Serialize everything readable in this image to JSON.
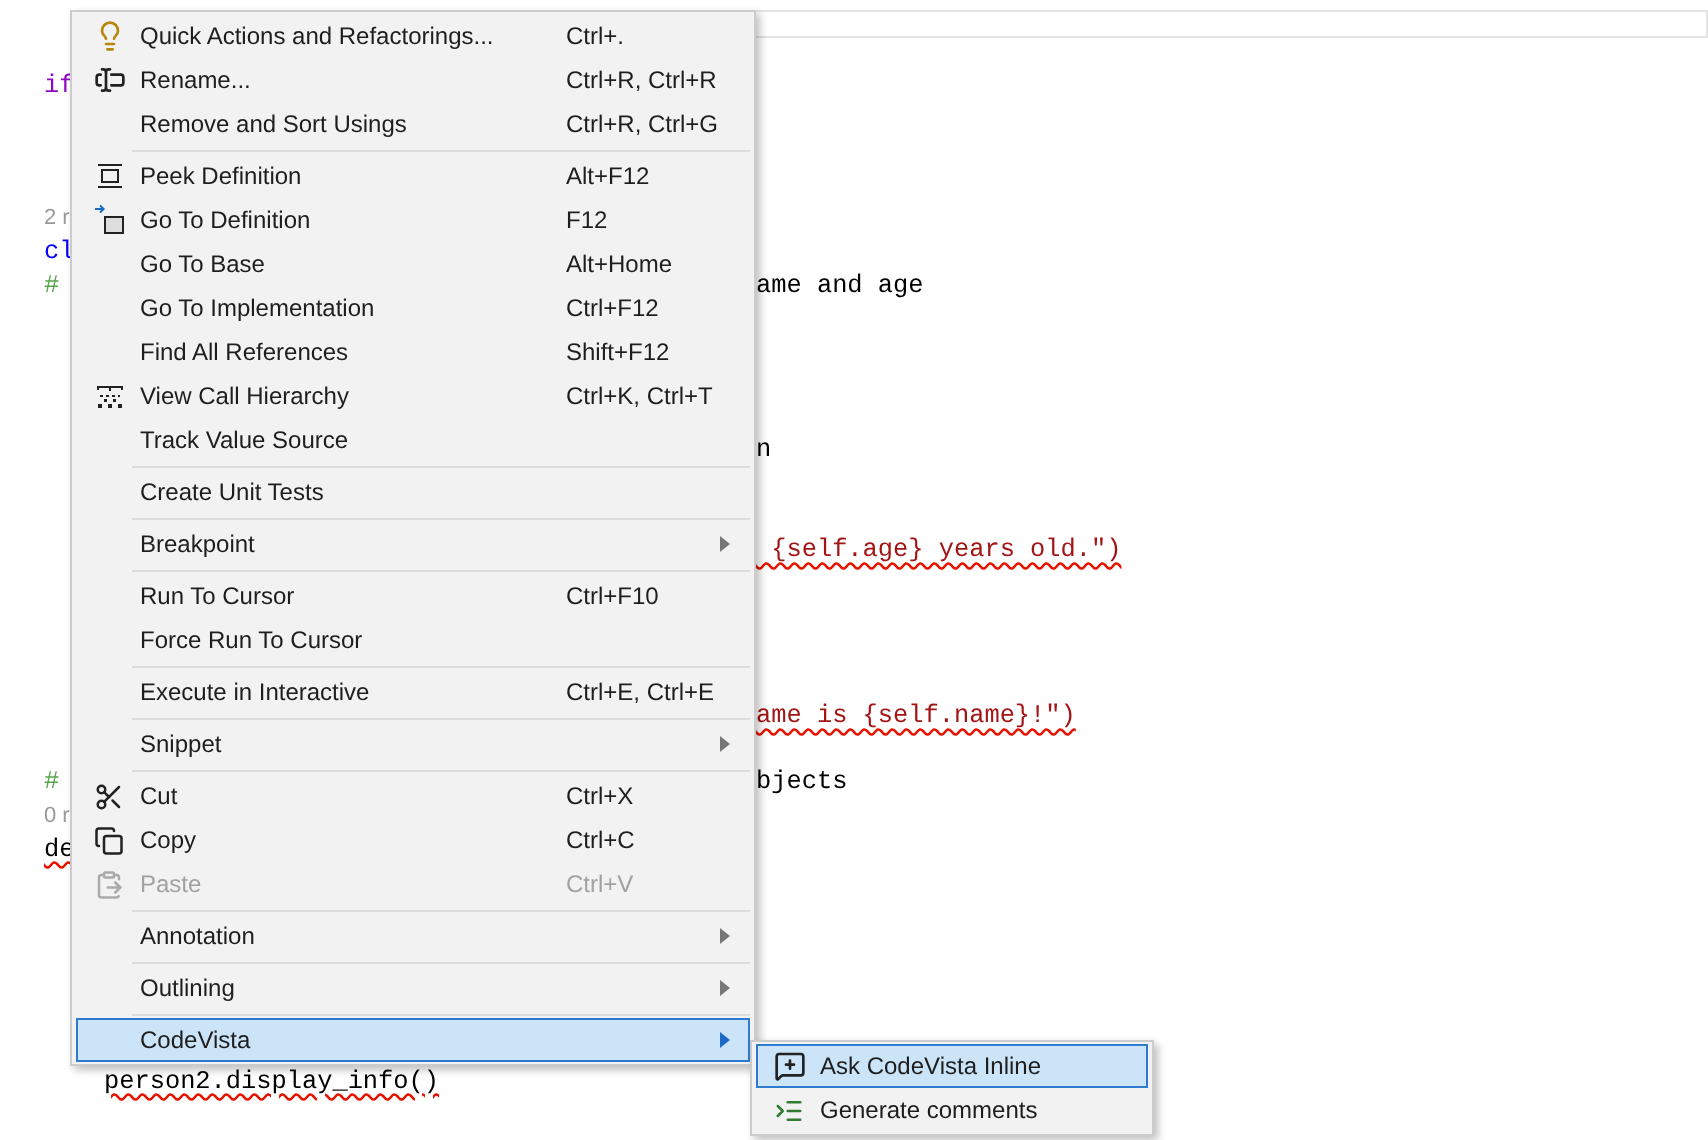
{
  "editor": {
    "lines": [
      {
        "kind": "code",
        "left": {
          "text": "if",
          "kind": "keyword",
          "error": false
        }
      },
      {
        "kind": "blank"
      },
      {
        "kind": "blank"
      },
      {
        "kind": "blank"
      },
      {
        "kind": "code",
        "left": {
          "text": "2 r",
          "kind": "lens",
          "error": false
        }
      },
      {
        "kind": "code",
        "left": {
          "text": "cl",
          "kind": "type",
          "error": false
        }
      },
      {
        "kind": "code",
        "left": {
          "text": "#",
          "kind": "comment",
          "error": false
        },
        "right": {
          "text": "ame and age",
          "kind": "plain",
          "error": false
        }
      },
      {
        "kind": "blank"
      },
      {
        "kind": "blank"
      },
      {
        "kind": "blank"
      },
      {
        "kind": "blank"
      },
      {
        "kind": "code",
        "right": {
          "text": "n",
          "kind": "plain",
          "error": false
        }
      },
      {
        "kind": "blank"
      },
      {
        "kind": "blank"
      },
      {
        "kind": "code",
        "right": {
          "text": " {self.age} years old.\")",
          "kind": "string",
          "error": true
        }
      },
      {
        "kind": "blank"
      },
      {
        "kind": "blank"
      },
      {
        "kind": "blank"
      },
      {
        "kind": "blank"
      },
      {
        "kind": "code",
        "right": {
          "text": "ame is {self.name}!\")",
          "kind": "string",
          "error": true
        }
      },
      {
        "kind": "blank"
      },
      {
        "kind": "code",
        "left": {
          "text": "#",
          "kind": "comment",
          "error": false
        },
        "right": {
          "text": "bjects",
          "kind": "plain",
          "error": false
        }
      },
      {
        "kind": "code",
        "left": {
          "text": "0 r",
          "kind": "lens",
          "error": false
        }
      },
      {
        "kind": "code",
        "left": {
          "text": "de",
          "kind": "plain",
          "error": true
        }
      },
      {
        "kind": "blank"
      },
      {
        "kind": "blank"
      },
      {
        "kind": "blank"
      },
      {
        "kind": "blank"
      },
      {
        "kind": "blank"
      },
      {
        "kind": "blank"
      },
      {
        "kind": "code",
        "left": {
          "text": "person2.display_info()",
          "kind": "indented",
          "error": true
        }
      }
    ]
  },
  "context_menu": {
    "items": [
      {
        "kind": "item",
        "label": "Quick Actions and Refactorings...",
        "shortcut": "Ctrl+.",
        "submenu": false,
        "disabled": false,
        "selected": false
      },
      {
        "kind": "item",
        "label": "Rename...",
        "shortcut": "Ctrl+R, Ctrl+R",
        "submenu": false,
        "disabled": false,
        "selected": false
      },
      {
        "kind": "item",
        "label": "Remove and Sort Usings",
        "shortcut": "Ctrl+R, Ctrl+G",
        "submenu": false,
        "disabled": false,
        "selected": false
      },
      {
        "kind": "separator"
      },
      {
        "kind": "item",
        "label": "Peek Definition",
        "shortcut": "Alt+F12",
        "submenu": false,
        "disabled": false,
        "selected": false
      },
      {
        "kind": "item",
        "label": "Go To Definition",
        "shortcut": "F12",
        "submenu": false,
        "disabled": false,
        "selected": false
      },
      {
        "kind": "item",
        "label": "Go To Base",
        "shortcut": "Alt+Home",
        "submenu": false,
        "disabled": false,
        "selected": false
      },
      {
        "kind": "item",
        "label": "Go To Implementation",
        "shortcut": "Ctrl+F12",
        "submenu": false,
        "disabled": false,
        "selected": false
      },
      {
        "kind": "item",
        "label": "Find All References",
        "shortcut": "Shift+F12",
        "submenu": false,
        "disabled": false,
        "selected": false
      },
      {
        "kind": "item",
        "label": "View Call Hierarchy",
        "shortcut": "Ctrl+K, Ctrl+T",
        "submenu": false,
        "disabled": false,
        "selected": false
      },
      {
        "kind": "item",
        "label": "Track Value Source",
        "submenu": false,
        "disabled": false,
        "selected": false
      },
      {
        "kind": "separator"
      },
      {
        "kind": "item",
        "label": "Create Unit Tests",
        "submenu": false,
        "disabled": false,
        "selected": false
      },
      {
        "kind": "separator"
      },
      {
        "kind": "item",
        "label": "Breakpoint",
        "submenu": true,
        "disabled": false,
        "selected": false
      },
      {
        "kind": "separator"
      },
      {
        "kind": "item",
        "label": "Run To Cursor",
        "shortcut": "Ctrl+F10",
        "submenu": false,
        "disabled": false,
        "selected": false
      },
      {
        "kind": "item",
        "label": "Force Run To Cursor",
        "submenu": false,
        "disabled": false,
        "selected": false
      },
      {
        "kind": "separator"
      },
      {
        "kind": "item",
        "label": "Execute in Interactive",
        "shortcut": "Ctrl+E, Ctrl+E",
        "submenu": false,
        "disabled": false,
        "selected": false
      },
      {
        "kind": "separator"
      },
      {
        "kind": "item",
        "label": "Snippet",
        "submenu": true,
        "disabled": false,
        "selected": false
      },
      {
        "kind": "separator"
      },
      {
        "kind": "item",
        "label": "Cut",
        "shortcut": "Ctrl+X",
        "submenu": false,
        "disabled": false,
        "selected": false
      },
      {
        "kind": "item",
        "label": "Copy",
        "shortcut": "Ctrl+C",
        "submenu": false,
        "disabled": false,
        "selected": false
      },
      {
        "kind": "item",
        "label": "Paste",
        "shortcut": "Ctrl+V",
        "submenu": false,
        "disabled": true,
        "selected": false
      },
      {
        "kind": "separator"
      },
      {
        "kind": "item",
        "label": "Annotation",
        "submenu": true,
        "disabled": false,
        "selected": false
      },
      {
        "kind": "separator"
      },
      {
        "kind": "item",
        "label": "Outlining",
        "submenu": true,
        "disabled": false,
        "selected": false
      },
      {
        "kind": "separator"
      },
      {
        "kind": "item",
        "label": "CodeVista",
        "submenu": true,
        "disabled": false,
        "selected": true
      }
    ]
  },
  "submenu": {
    "items": [
      {
        "label": "Ask CodeVista Inline",
        "selected": true
      },
      {
        "label": "Generate comments",
        "selected": false
      }
    ]
  }
}
